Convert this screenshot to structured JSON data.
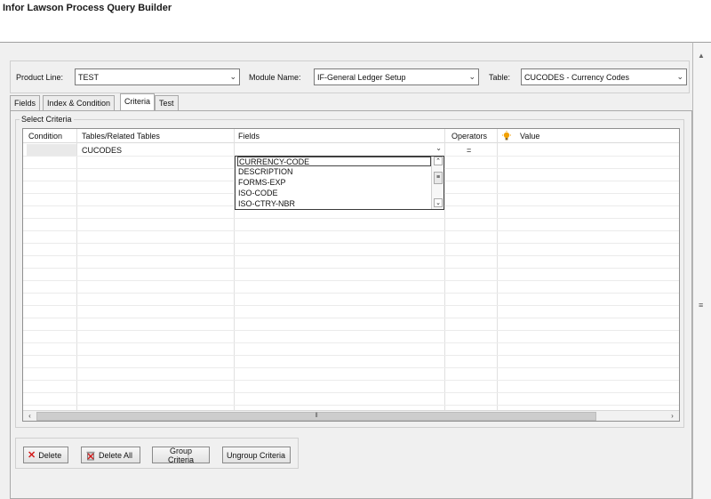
{
  "window": {
    "title": "Infor Lawson Process Query Builder"
  },
  "selectors": {
    "product_line": {
      "label": "Product Line:",
      "value": "TEST"
    },
    "module_name": {
      "label": "Module Name:",
      "value": "IF-General Ledger Setup"
    },
    "table": {
      "label": "Table:",
      "value": "CUCODES - Currency Codes"
    }
  },
  "tabs": [
    {
      "label": "Fields",
      "active": false
    },
    {
      "label": "Index & Condition",
      "active": false
    },
    {
      "label": "Criteria",
      "active": true
    },
    {
      "label": "Test",
      "active": false
    }
  ],
  "criteria": {
    "legend": "Select Criteria",
    "columns": [
      "Condition",
      "Tables/Related Tables",
      "Fields",
      "Operators",
      "Value"
    ],
    "row": {
      "condition": "",
      "table": "CUCODES",
      "field": "",
      "operator": "=",
      "value": ""
    },
    "field_options": [
      "CURRENCY-CODE",
      "DESCRIPTION",
      "FORMS-EXP",
      "ISO-CODE",
      "ISO-CTRY-NBR"
    ],
    "selected_option": "CURRENCY-CODE"
  },
  "buttons": {
    "delete": "Delete",
    "delete_all": "Delete All",
    "group": "Group Criteria",
    "ungroup": "Ungroup Criteria"
  },
  "icons": {
    "value_header": "lightbulb-icon",
    "delete": "red-x-icon",
    "delete_all": "trash-icon"
  },
  "colors": {
    "delete_icon": "#d21b1b",
    "lightbulb": "#f2a100"
  }
}
